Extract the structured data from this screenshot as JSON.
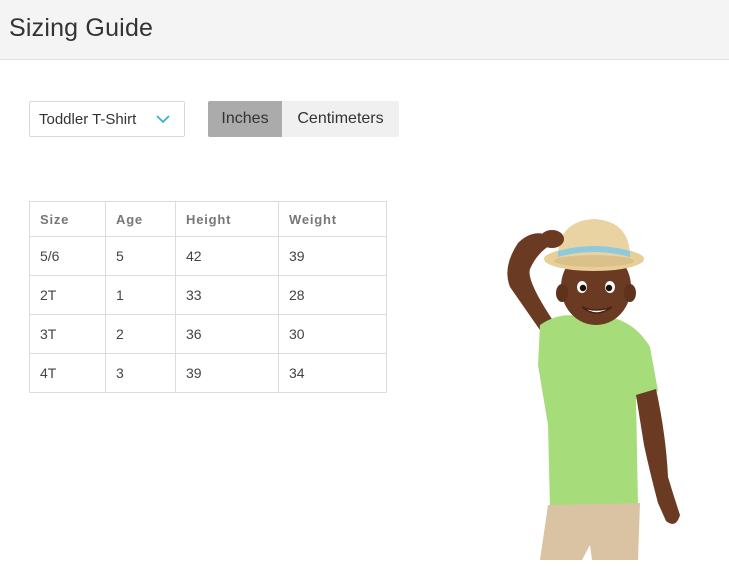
{
  "header": {
    "title": "Sizing Guide"
  },
  "product_select": {
    "value": "Toddler T-Shirt"
  },
  "units_toggle": {
    "options": [
      "Inches",
      "Centimeters"
    ],
    "selected": "Inches"
  },
  "table": {
    "columns": [
      "Size",
      "Age",
      "Height",
      "Weight"
    ],
    "rows": [
      [
        "5/6",
        "5",
        "42",
        "39"
      ],
      [
        "2T",
        "1",
        "33",
        "28"
      ],
      [
        "3T",
        "2",
        "36",
        "30"
      ],
      [
        "4T",
        "3",
        "39",
        "34"
      ]
    ]
  },
  "colors": {
    "accent": "#2bb3c0",
    "active_toggle": "#ababab",
    "inactive_toggle": "#f0f0f0",
    "header_bg": "#f4f4f4"
  }
}
